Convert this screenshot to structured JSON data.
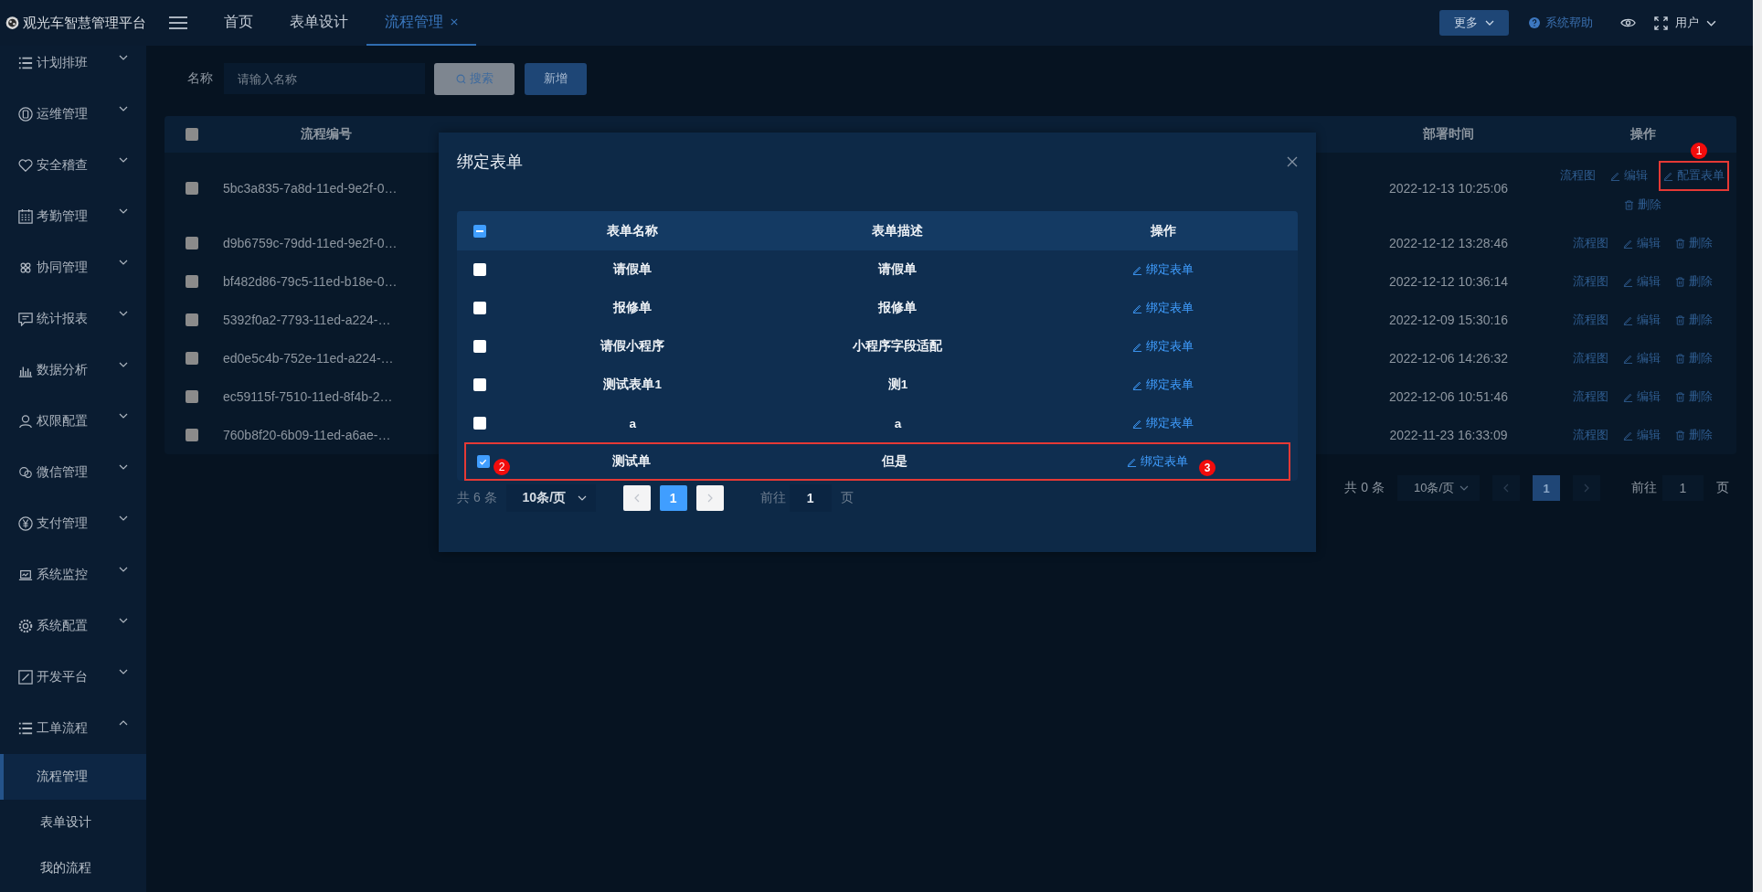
{
  "app": {
    "title": "观光车智慧管理平台"
  },
  "tabs": [
    {
      "label": "首页",
      "selected": false,
      "closable": false
    },
    {
      "label": "表单设计",
      "selected": false,
      "closable": false
    },
    {
      "label": "流程管理",
      "selected": true,
      "closable": true
    }
  ],
  "header": {
    "more": "更多",
    "help": "系统帮助",
    "user": "用户"
  },
  "sidebar": {
    "items": [
      {
        "label": "计划排班",
        "expanded": false
      },
      {
        "label": "运维管理",
        "expanded": false
      },
      {
        "label": "安全稽查",
        "expanded": false
      },
      {
        "label": "考勤管理",
        "expanded": false
      },
      {
        "label": "协同管理",
        "expanded": false
      },
      {
        "label": "统计报表",
        "expanded": false
      },
      {
        "label": "数据分析",
        "expanded": false
      },
      {
        "label": "权限配置",
        "expanded": false
      },
      {
        "label": "微信管理",
        "expanded": false
      },
      {
        "label": "支付管理",
        "expanded": false
      },
      {
        "label": "系统监控",
        "expanded": false
      },
      {
        "label": "系统配置",
        "expanded": false
      },
      {
        "label": "开发平台",
        "expanded": false
      },
      {
        "label": "工单流程",
        "expanded": true,
        "children": [
          {
            "label": "流程管理",
            "selected": true
          },
          {
            "label": "表单设计",
            "selected": false
          },
          {
            "label": "我的流程",
            "selected": false
          }
        ]
      }
    ]
  },
  "search": {
    "label": "名称",
    "placeholder": "请输入名称",
    "search_button": "搜索",
    "add_button": "新增"
  },
  "table": {
    "header_checked": false,
    "columns": [
      "流程编号",
      "部署时间",
      "操作"
    ],
    "rows": [
      {
        "checked": false,
        "id": "5bc3a835-7a8d-11ed-9e2f-0…",
        "time": "2022-12-13 10:25:06",
        "actions": [
          {
            "kind": "link",
            "label": "流程图",
            "highlighted": false
          },
          {
            "kind": "edit",
            "label": "编辑",
            "highlighted": false
          },
          {
            "kind": "edit",
            "label": "配置表单",
            "highlighted": true,
            "marker": "1"
          },
          {
            "kind": "delete",
            "label": "删除",
            "highlighted": false
          }
        ]
      },
      {
        "checked": false,
        "id": "d9b6759c-79dd-11ed-9e2f-0…",
        "time": "2022-12-12 13:28:46",
        "actions": [
          {
            "kind": "link",
            "label": "流程图",
            "highlighted": false
          },
          {
            "kind": "edit",
            "label": "编辑",
            "highlighted": false
          },
          {
            "kind": "delete",
            "label": "删除",
            "highlighted": false
          }
        ]
      },
      {
        "checked": false,
        "id": "bf482d86-79c5-11ed-b18e-0…",
        "time": "2022-12-12 10:36:14",
        "actions": [
          {
            "kind": "link",
            "label": "流程图",
            "highlighted": false
          },
          {
            "kind": "edit",
            "label": "编辑",
            "highlighted": false
          },
          {
            "kind": "delete",
            "label": "删除",
            "highlighted": false
          }
        ]
      },
      {
        "checked": false,
        "id": "5392f0a2-7793-11ed-a224-…",
        "time": "2022-12-09 15:30:16",
        "actions": [
          {
            "kind": "link",
            "label": "流程图",
            "highlighted": false
          },
          {
            "kind": "edit",
            "label": "编辑",
            "highlighted": false
          },
          {
            "kind": "delete",
            "label": "删除",
            "highlighted": false
          }
        ]
      },
      {
        "checked": false,
        "id": "ed0e5c4b-752e-11ed-a224-…",
        "time": "2022-12-06 14:26:32",
        "actions": [
          {
            "kind": "link",
            "label": "流程图",
            "highlighted": false
          },
          {
            "kind": "edit",
            "label": "编辑",
            "highlighted": false
          },
          {
            "kind": "delete",
            "label": "删除",
            "highlighted": false
          }
        ]
      },
      {
        "checked": false,
        "id": "ec59115f-7510-11ed-8f4b-2…",
        "time": "2022-12-06 10:51:46",
        "actions": [
          {
            "kind": "link",
            "label": "流程图",
            "highlighted": false
          },
          {
            "kind": "edit",
            "label": "编辑",
            "highlighted": false
          },
          {
            "kind": "delete",
            "label": "删除",
            "highlighted": false
          }
        ]
      },
      {
        "checked": false,
        "id": "760b8f20-6b09-11ed-a6ae-…",
        "time": "2022-11-23 16:33:09",
        "actions": [
          {
            "kind": "link",
            "label": "流程图",
            "highlighted": false
          },
          {
            "kind": "edit",
            "label": "编辑",
            "highlighted": false
          },
          {
            "kind": "delete",
            "label": "删除",
            "highlighted": false
          }
        ]
      }
    ]
  },
  "pagination": {
    "total": "共 0 条",
    "page_size": "10条/页",
    "current": "1",
    "goto_label": "前往",
    "goto_value": "1",
    "page_suffix": "页"
  },
  "dialog": {
    "title": "绑定表单",
    "header_indeterminate": true,
    "columns": [
      "表单名称",
      "表单描述",
      "操作"
    ],
    "rows": [
      {
        "checked": false,
        "highlighted": false,
        "name": "请假单",
        "description": "请假单",
        "action": "绑定表单"
      },
      {
        "checked": false,
        "highlighted": false,
        "name": "报修单",
        "description": "报修单",
        "action": "绑定表单"
      },
      {
        "checked": false,
        "highlighted": false,
        "name": "请假小程序",
        "description": "小程序字段适配",
        "action": "绑定表单"
      },
      {
        "checked": false,
        "highlighted": false,
        "name": "测试表单1",
        "description": "测1",
        "action": "绑定表单"
      },
      {
        "checked": false,
        "highlighted": false,
        "name": "a",
        "description": "a",
        "action": "绑定表单"
      },
      {
        "checked": true,
        "highlighted": true,
        "name": "测试单",
        "description": "但是",
        "action": "绑定表单",
        "check_marker": "2",
        "action_marker": "3"
      }
    ],
    "pagination": {
      "total": "共 6 条",
      "page_size": "10条/页",
      "current": "1",
      "goto_label": "前往",
      "goto_value": "1",
      "page_suffix": "页"
    }
  }
}
